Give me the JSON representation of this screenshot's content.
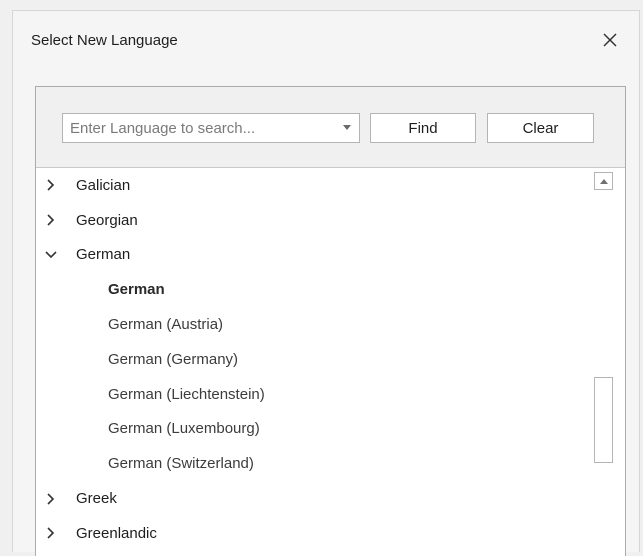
{
  "dialog": {
    "title": "Select New Language"
  },
  "search": {
    "placeholder": "Enter Language to search...",
    "value": "",
    "find_label": "Find",
    "clear_label": "Clear"
  },
  "tree": {
    "items": [
      {
        "label": "Galician",
        "type": "group",
        "expanded": false
      },
      {
        "label": "Georgian",
        "type": "group",
        "expanded": false
      },
      {
        "label": "German",
        "type": "group",
        "expanded": true
      },
      {
        "label": "German",
        "type": "child",
        "bold": true
      },
      {
        "label": "German (Austria)",
        "type": "child"
      },
      {
        "label": "German (Germany)",
        "type": "child"
      },
      {
        "label": "German (Liechtenstein)",
        "type": "child"
      },
      {
        "label": "German (Luxembourg)",
        "type": "child"
      },
      {
        "label": "German (Switzerland)",
        "type": "child"
      },
      {
        "label": "Greek",
        "type": "group",
        "expanded": false
      },
      {
        "label": "Greenlandic",
        "type": "group",
        "expanded": false
      }
    ]
  },
  "icons": {
    "close": "close-icon",
    "collapsed": "chevron-right-icon",
    "expanded": "chevron-down-icon",
    "scroll_up": "scroll-up-arrow-icon",
    "dropdown": "dropdown-arrow-icon"
  },
  "colors": {
    "dialog_bg": "#f5f5f5",
    "panel_bg": "#ffffff",
    "text": "#1e1e1e"
  }
}
